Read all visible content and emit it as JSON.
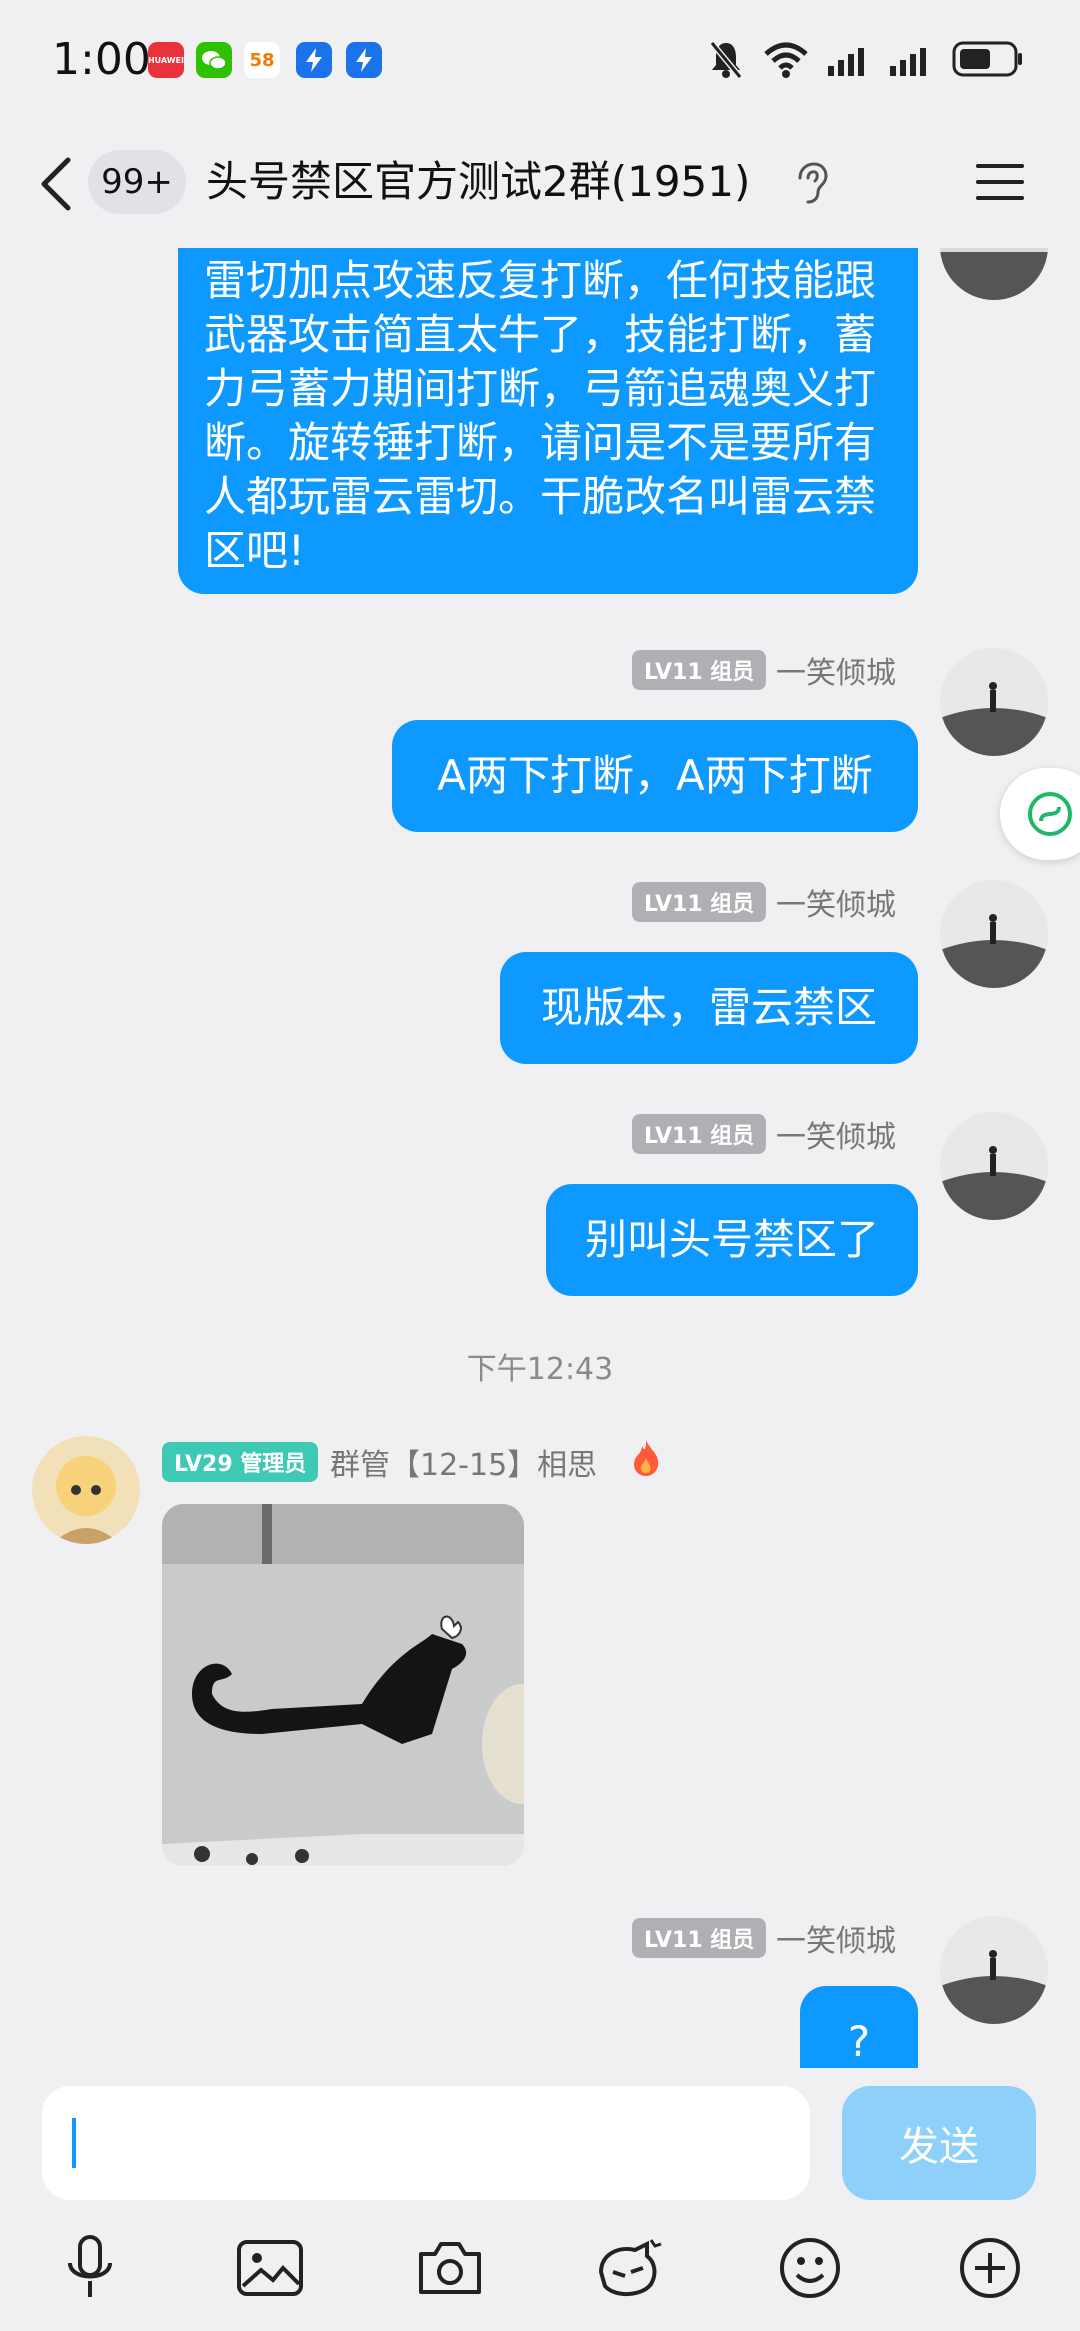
{
  "status_bar": {
    "time": "1:00",
    "app_icons": [
      "huawei-icon",
      "wechat-icon",
      "58-icon",
      "lightning-icon",
      "lightning-icon"
    ],
    "app_58_text": "58",
    "huawei_text": "HUAWEI",
    "right_icons": [
      "mute-icon",
      "wifi-icon",
      "signal-icon",
      "signal-icon",
      "battery-icon"
    ]
  },
  "header": {
    "unread": "99+",
    "title": "头号禁区官方测试2群(1951)"
  },
  "messages": {
    "m1_text": "雷切加点攻速反复打断，任何技能跟武器攻击简直太牛了，技能打断，蓄力弓蓄力期间打断，弓箭追魂奥义打断。旋转锤打断，请问是不是要所有人都玩雷云雷切。干脆改名叫雷云禁区吧!",
    "m2": {
      "badge": "LV11 组员",
      "nick": "一笑倾城",
      "text": "A两下打断，A两下打断"
    },
    "m3": {
      "badge": "LV11 组员",
      "nick": "一笑倾城",
      "text": "现版本，雷云禁区"
    },
    "m4": {
      "badge": "LV11 组员",
      "nick": "一笑倾城",
      "text": "别叫头号禁区了"
    },
    "timestamp": "下午12:43",
    "m5": {
      "badge": "LV29 管理员",
      "nick": "群管【12-15】相思"
    },
    "m6": {
      "badge": "LV11 组员",
      "nick": "一笑倾城",
      "text": "?"
    }
  },
  "input": {
    "value": "",
    "send_label": "发送"
  },
  "toolbar": [
    "mic-icon",
    "image-icon",
    "camera-icon",
    "sticker-icon",
    "emoji-icon",
    "plus-icon"
  ],
  "colors": {
    "bubble": "#0d99ff",
    "badge_member": "#b0b0b4",
    "badge_admin": "#3ec9b4",
    "send_disabled": "#8fd0fb"
  }
}
